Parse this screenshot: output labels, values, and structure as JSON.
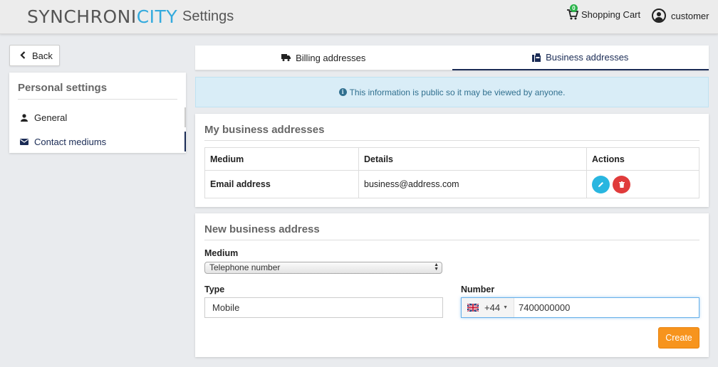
{
  "header": {
    "logo_part1": "SYNCHRONI",
    "logo_part2": "CITY",
    "page_title": "Settings",
    "cart_count": "0",
    "cart_label": "Shopping Cart",
    "user_label": "customer"
  },
  "back_label": "Back",
  "sidebar": {
    "title": "Personal settings",
    "items": [
      {
        "label": "General",
        "icon": "user-icon"
      },
      {
        "label": "Contact mediums",
        "icon": "envelope-icon",
        "active": true
      }
    ]
  },
  "tabs": [
    {
      "label": "Billing addresses",
      "icon": "truck-icon"
    },
    {
      "label": "Business addresses",
      "icon": "fax-icon",
      "active": true
    }
  ],
  "alert": {
    "icon": "info-circle-icon",
    "text": "This information is public so it may be viewed by anyone."
  },
  "business_addresses": {
    "title": "My business addresses",
    "columns": [
      "Medium",
      "Details",
      "Actions"
    ],
    "rows": [
      {
        "medium": "Email address",
        "details": "business@address.com"
      }
    ]
  },
  "new_address": {
    "title": "New business address",
    "medium_label": "Medium",
    "medium_value": "Telephone number",
    "type_label": "Type",
    "type_value": "Mobile",
    "number_label": "Number",
    "country_code": "+44",
    "number_value": "7400000000",
    "create_label": "Create"
  },
  "colors": {
    "accent": "#1a2b55",
    "brand_blue": "#33aadd",
    "create": "#f7941d",
    "edit": "#29b6e0",
    "delete": "#e03b3b",
    "cart_badge": "#2ab34a"
  }
}
